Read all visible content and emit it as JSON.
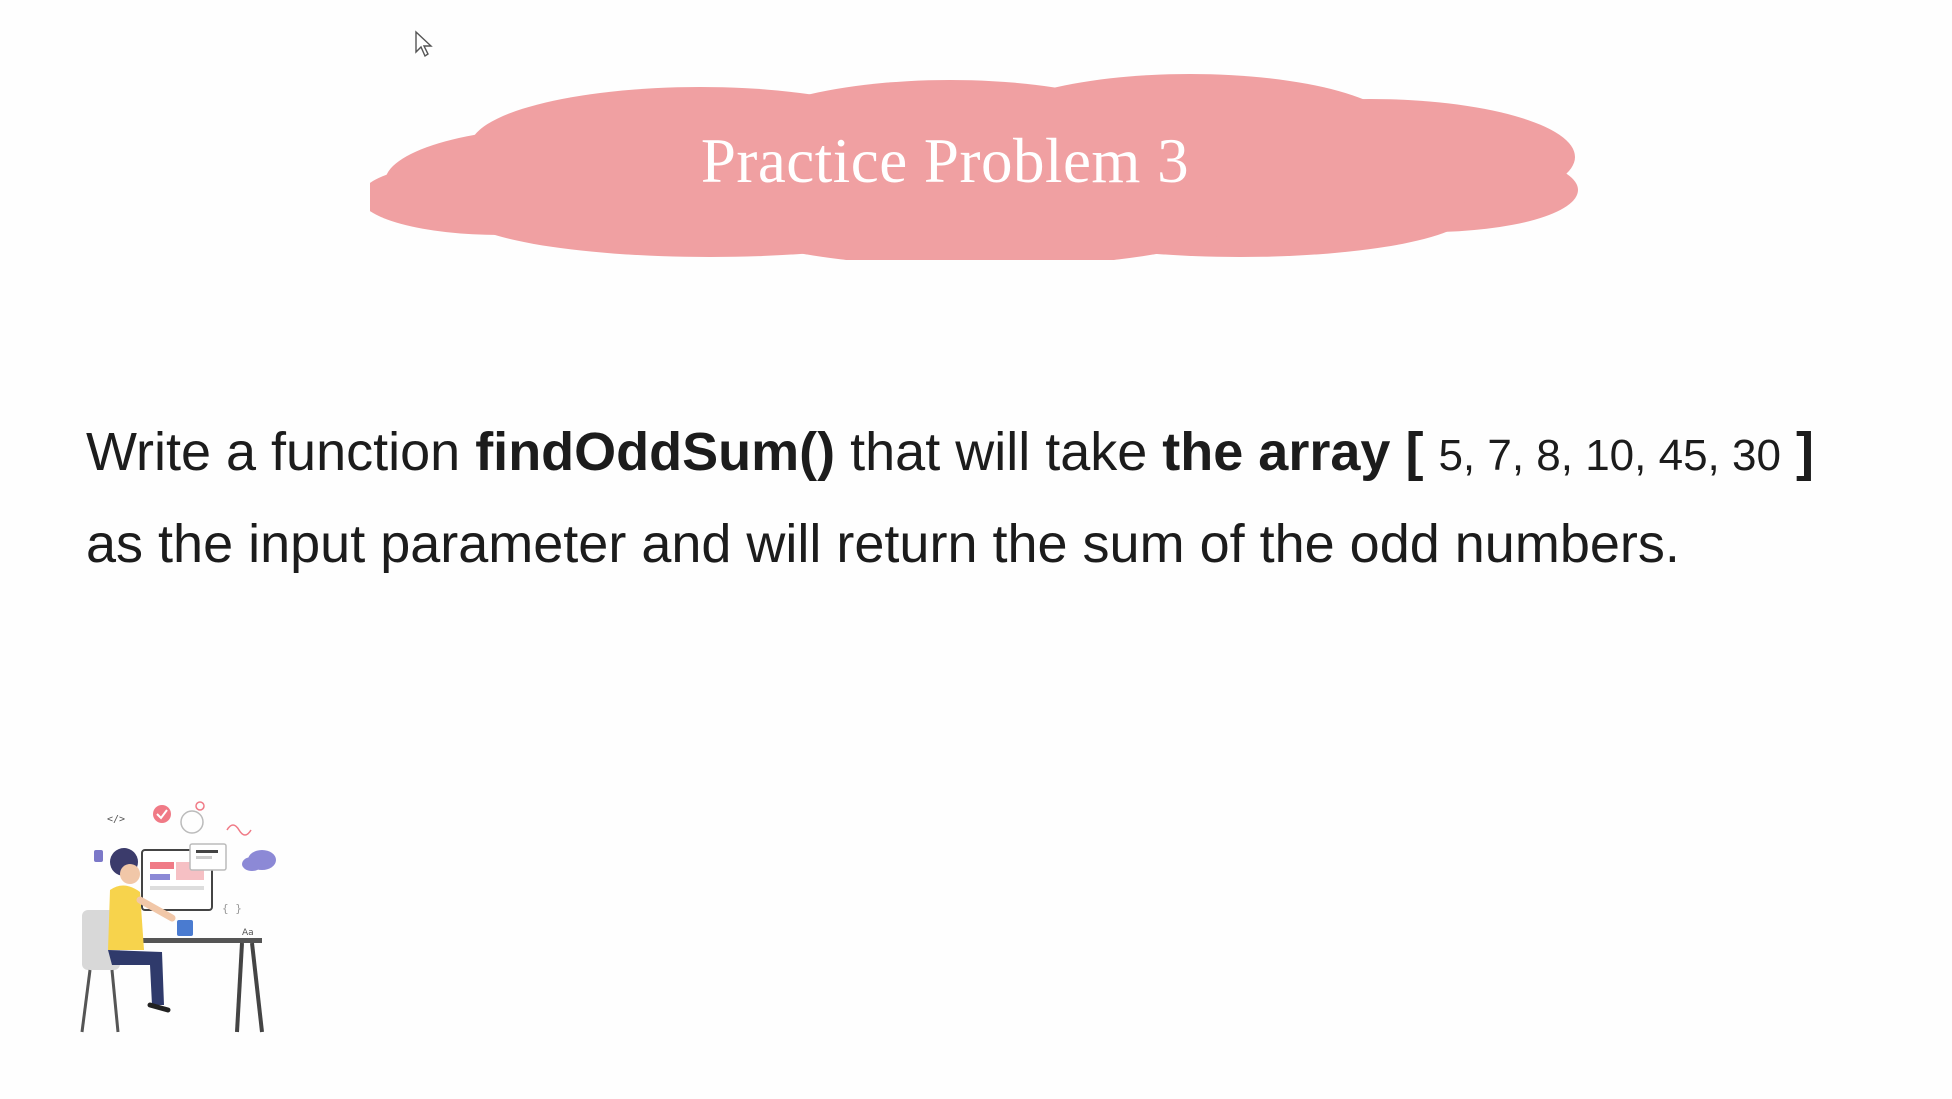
{
  "slide": {
    "title": "Practice Problem 3",
    "problem": {
      "part1": "Write a function",
      "function_name": "findOddSum()",
      "part2": "that will take",
      "array_label": "the array",
      "open_bracket": "[",
      "array_values": "5, 7, 8, 10, 45, 30",
      "close_bracket": "]",
      "line2": "as the input parameter and will return the sum of the odd numbers."
    }
  },
  "icons": {
    "cursor": "mouse-pointer-icon",
    "illustration": "developer-at-desk-illustration"
  },
  "colors": {
    "cloud": "#f0a0a2",
    "title_text": "#ffffff",
    "body_text": "#1c1c1c",
    "background": "#fefefe"
  }
}
